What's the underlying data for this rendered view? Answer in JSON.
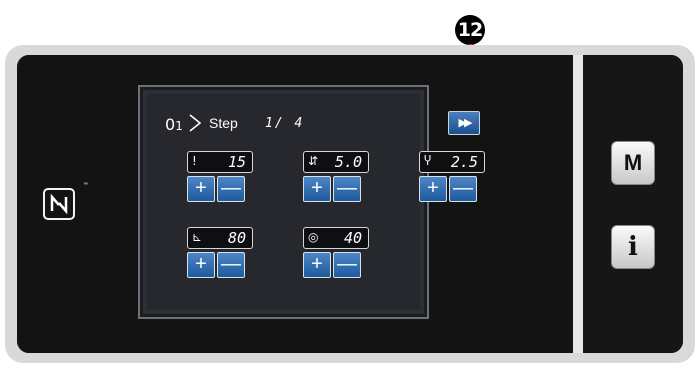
{
  "callout": {
    "number": "12"
  },
  "screen": {
    "step_icon": "0̂1",
    "step_label": "Step",
    "step_counter": "1/ 4",
    "next_button_label": "▶▶",
    "params": [
      {
        "icon": "!",
        "value": "15"
      },
      {
        "icon": "⇵",
        "value": "5.0"
      },
      {
        "icon": "Ⴤ",
        "value": "2.5"
      },
      {
        "icon": "⊾",
        "value": "80"
      },
      {
        "icon": "◎",
        "value": "40"
      }
    ],
    "plus_label": "+",
    "minus_label": "—"
  },
  "keys": {
    "m_label": "M",
    "info_label": "i"
  },
  "brand": {
    "tm": "™"
  }
}
